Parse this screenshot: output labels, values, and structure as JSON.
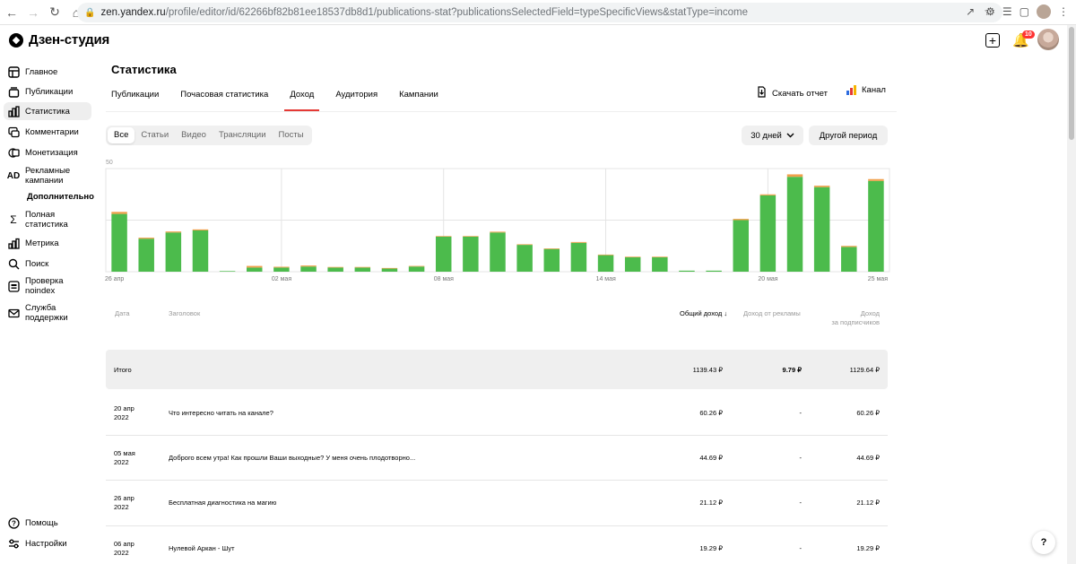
{
  "browser": {
    "url_host": "zen.yandex.ru",
    "url_path": "/profile/editor/id/62266bf82b81ee18537db8d1/publications-stat?publicationsSelectedField=typeSpecificViews&statType=income"
  },
  "header": {
    "logo_text": "Дзен-студия",
    "notification_count": "10"
  },
  "sidebar": {
    "items": [
      {
        "label": "Главное",
        "icon": "home-icon"
      },
      {
        "label": "Публикации",
        "icon": "publications-icon"
      },
      {
        "label": "Статистика",
        "icon": "stats-icon",
        "active": true
      },
      {
        "label": "Комментарии",
        "icon": "comments-icon"
      },
      {
        "label": "Монетизация",
        "icon": "monetization-icon"
      },
      {
        "label": "Рекламные кампании",
        "icon": "ad-icon"
      },
      {
        "label": "Полная статистика",
        "icon": "sigma-icon"
      },
      {
        "label": "Метрика",
        "icon": "metrika-icon"
      },
      {
        "label": "Поиск",
        "icon": "search-icon"
      },
      {
        "label": "Проверка noindex",
        "icon": "check-icon"
      },
      {
        "label": "Служба поддержки",
        "icon": "mail-icon"
      }
    ],
    "section_heading": "Дополнительно",
    "footer": [
      {
        "label": "Помощь",
        "icon": "help-icon"
      },
      {
        "label": "Настройки",
        "icon": "settings-icon"
      }
    ]
  },
  "main": {
    "title": "Статистика",
    "tabs": [
      "Публикации",
      "Почасовая статистика",
      "Доход",
      "Аудитория",
      "Кампании"
    ],
    "active_tab": "Доход",
    "report_button": "Скачать отчет",
    "channel_button": "Канал",
    "filters": [
      "Все",
      "Статьи",
      "Видео",
      "Трансляции",
      "Посты"
    ],
    "active_filter": "Все",
    "period_label": "30 дней",
    "other_period_label": "Другой период"
  },
  "chart_data": {
    "type": "bar",
    "ytick_label": "50",
    "ylim": [
      0,
      50
    ],
    "xtick_labels": [
      "26 апр",
      "02 мая",
      "08 мая",
      "14 мая",
      "20 мая",
      "25 мая"
    ],
    "series": [
      {
        "name": "Доход за подписчиков",
        "color": "#4cbb4c",
        "values": [
          28,
          16,
          19,
          20,
          0.3,
          2,
          2,
          2.5,
          2,
          2,
          1.5,
          2.5,
          17,
          17,
          19,
          13,
          11,
          14,
          8,
          7,
          7,
          0.5,
          0.5,
          25,
          37,
          46,
          41,
          12,
          44
        ]
      },
      {
        "name": "Доход от рекламы",
        "color": "#f0a04b",
        "values": [
          1,
          0.5,
          0.5,
          0.5,
          0,
          0.8,
          0.4,
          0.5,
          0.3,
          0.3,
          0.3,
          0.3,
          0.3,
          0.3,
          0.4,
          0.3,
          0.3,
          0.4,
          0.3,
          0.3,
          0.3,
          0,
          0,
          0.6,
          0.5,
          1.2,
          0.7,
          0.5,
          0.9
        ]
      }
    ]
  },
  "table": {
    "headers": {
      "date": "Дата",
      "title": "Заголовок",
      "total": "Общий доход",
      "ads": "Доход от рекламы",
      "subs_line1": "Доход",
      "subs_line2": "за подписчиков"
    },
    "total_row": {
      "label": "Итого",
      "total": "1139.43 ₽",
      "ads": "9.79 ₽",
      "subs": "1129.64 ₽"
    },
    "rows": [
      {
        "date1": "20 апр",
        "date2": "2022",
        "title": "Что интересно читать на канале?",
        "total": "60.26 ₽",
        "ads": "-",
        "subs": "60.26 ₽"
      },
      {
        "date1": "05 мая",
        "date2": "2022",
        "title": "Доброго всем утра! Как прошли Ваши выходные? У меня очень плодотворно...",
        "total": "44.69 ₽",
        "ads": "-",
        "subs": "44.69 ₽"
      },
      {
        "date1": "26 апр",
        "date2": "2022",
        "title": "Бесплатная диагностика на магию",
        "total": "21.12 ₽",
        "ads": "-",
        "subs": "21.12 ₽"
      },
      {
        "date1": "06 апр",
        "date2": "2022",
        "title": "Нулевой Аркан - Шут",
        "total": "19.29 ₽",
        "ads": "-",
        "subs": "19.29 ₽"
      }
    ]
  },
  "help_fab": "?"
}
